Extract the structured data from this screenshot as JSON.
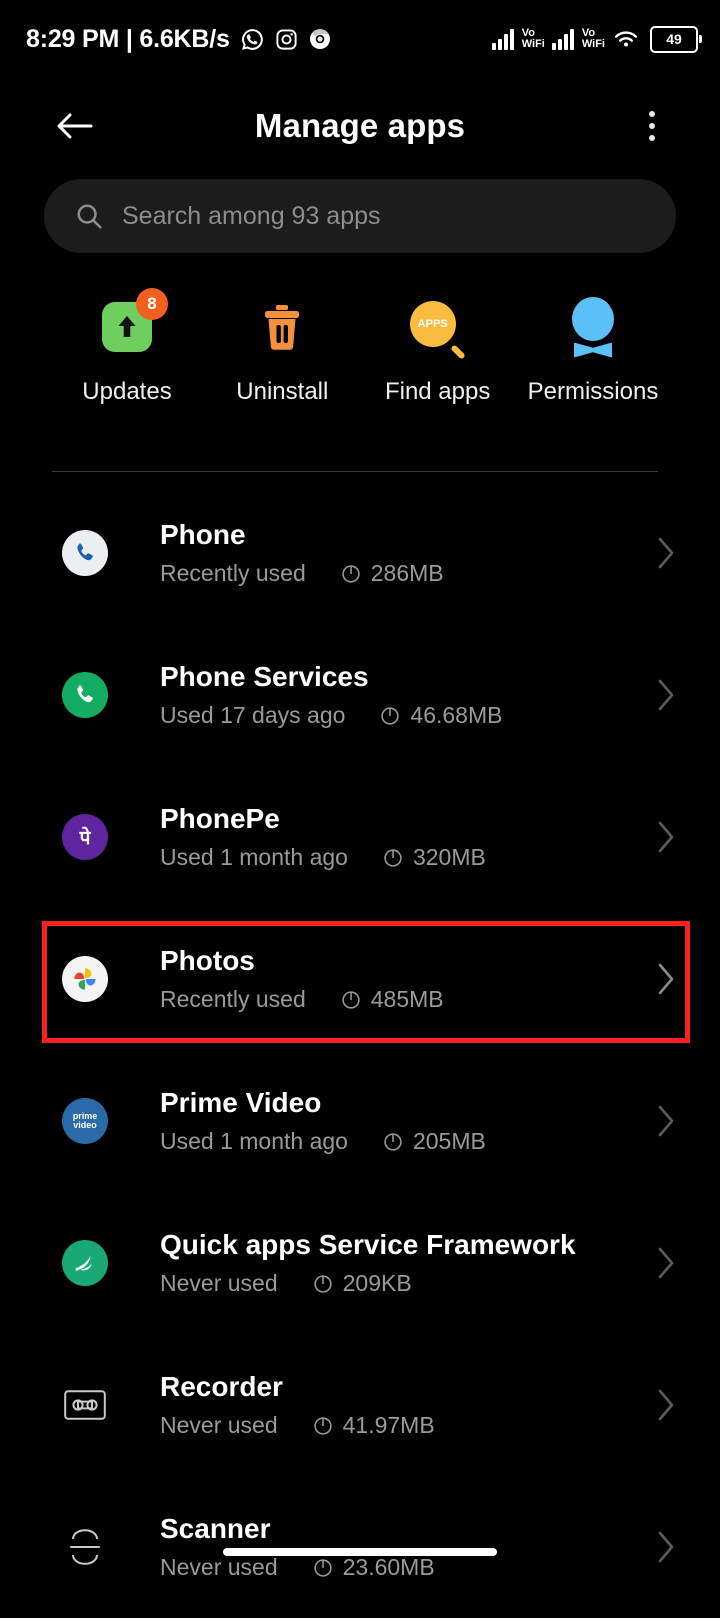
{
  "statusbar": {
    "clock": "8:29 PM | 6.6KB/s",
    "app_icons": [
      "whatsapp-icon",
      "instagram-icon",
      "chrome-icon"
    ],
    "network_labels": [
      "VoWiFi",
      "VoWiFi"
    ],
    "wifi": "wifi-icon",
    "battery_level": "49"
  },
  "appbar": {
    "back": "back-arrow-icon",
    "title": "Manage apps",
    "overflow": "more-options-icon"
  },
  "search": {
    "icon": "search-icon",
    "placeholder": "Search among 93 apps",
    "value": ""
  },
  "quick_actions": [
    {
      "label": "Updates",
      "icon": "updates-icon",
      "badge": "8"
    },
    {
      "label": "Uninstall",
      "icon": "uninstall-icon",
      "badge": ""
    },
    {
      "label": "Find apps",
      "icon": "find-apps-icon",
      "badge": "",
      "icon_text": "APPS"
    },
    {
      "label": "Permissions",
      "icon": "permissions-icon",
      "badge": ""
    }
  ],
  "apps": [
    {
      "name": "Phone",
      "usage": "Recently used",
      "size": "286MB",
      "icon": "phone-app-icon"
    },
    {
      "name": "Phone Services",
      "usage": "Used 17 days ago",
      "size": "46.68MB",
      "icon": "phone-services-app-icon"
    },
    {
      "name": "PhonePe",
      "usage": "Used 1 month ago",
      "size": "320MB",
      "icon": "phonepe-app-icon",
      "icon_text": "पे"
    },
    {
      "name": "Photos",
      "usage": "Recently used",
      "size": "485MB",
      "icon": "photos-app-icon",
      "highlighted": true
    },
    {
      "name": "Prime Video",
      "usage": "Used 1 month ago",
      "size": "205MB",
      "icon": "prime-video-app-icon",
      "icon_text": "prime video"
    },
    {
      "name": "Quick apps Service Framework",
      "usage": "Never used",
      "size": "209KB",
      "icon": "quick-apps-app-icon"
    },
    {
      "name": "Recorder",
      "usage": "Never used",
      "size": "41.97MB",
      "icon": "recorder-app-icon"
    },
    {
      "name": "Scanner",
      "usage": "Never used",
      "size": "23.60MB",
      "icon": "scanner-app-icon"
    }
  ],
  "colors": {
    "background": "#000000",
    "highlight": "#fb2020",
    "updates_green": "#6ecf5e",
    "badge_orange": "#f2601f",
    "uninstall_orange": "#f5913e",
    "find_amber": "#f9bc3f",
    "permissions_blue": "#5bc0f8",
    "subtitle_gray": "#9a9a9a",
    "search_field": "#1c1c1c"
  }
}
